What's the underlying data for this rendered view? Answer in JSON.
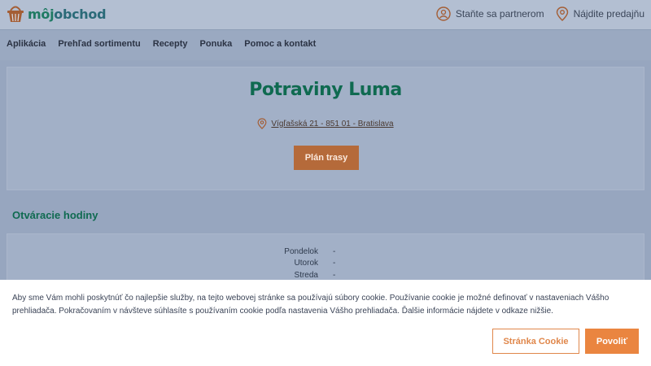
{
  "header": {
    "logo_part1": "môj",
    "logo_part2": "obchod",
    "links": [
      {
        "label": "Staňte sa partnerom",
        "icon": "partner-icon"
      },
      {
        "label": "Nájdite predajňu",
        "icon": "location-pin-icon"
      }
    ]
  },
  "nav": {
    "items": [
      "Aplikácia",
      "Prehľad sortimentu",
      "Recepty",
      "Ponuka",
      "Pomoc a kontakt"
    ]
  },
  "store": {
    "name": "Potraviny Luma",
    "address": "Vígľašská 21 - 851 01 - Bratislava",
    "route_button": "Plán trasy"
  },
  "hours": {
    "title": "Otváracie hodiny",
    "rows": [
      {
        "day": "Pondelok",
        "value": "-"
      },
      {
        "day": "Utorok",
        "value": "-"
      },
      {
        "day": "Streda",
        "value": "-"
      }
    ]
  },
  "cookie": {
    "text": "Aby sme Vám mohli poskytnúť čo najlepšie služby, na tejto webovej stránke sa používajú súbory cookie. Používanie cookie je možné definovať v nastaveniach Vášho prehliadača. Pokračovaním v návšteve súhlasíte s používaním cookie podľa nastavenia Vášho prehliadača. Ďalšie informácie nájdete v odkaze nižšie.",
    "settings_button": "Stránka Cookie",
    "allow_button": "Povoliť"
  },
  "colors": {
    "brand_green": "#0f6a50",
    "accent_orange": "#ea8540",
    "overlay": "#97a6bf"
  }
}
